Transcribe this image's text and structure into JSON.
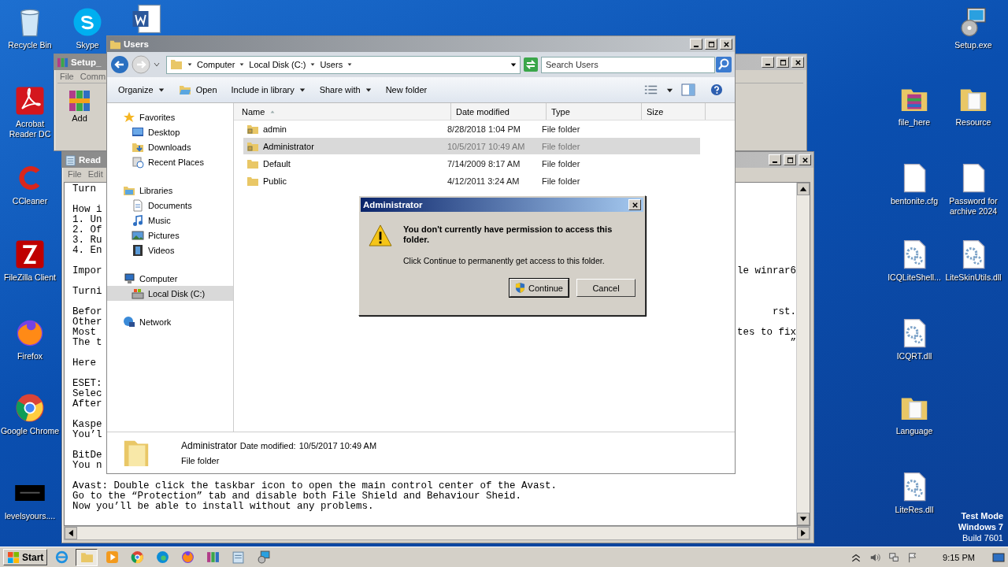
{
  "desktop_icons": [
    {
      "label": "Recycle Bin",
      "kind": "recycle"
    },
    {
      "label": "Skype",
      "kind": "skype"
    },
    {
      "kind": "word"
    },
    {
      "label": "Acrobat Reader DC",
      "kind": "pdf"
    },
    {
      "label": "CCleaner",
      "kind": "ccleaner"
    },
    {
      "label": "FileZilla Client",
      "kind": "filezilla"
    },
    {
      "label": "Firefox",
      "kind": "firefox"
    },
    {
      "label": "Google Chrome",
      "kind": "chrome"
    },
    {
      "label": "levelsyours....",
      "kind": "black"
    },
    {
      "label": "Setup.exe",
      "kind": "setup"
    },
    {
      "label": "file_here",
      "kind": "archive-folder"
    },
    {
      "label": "Resource",
      "kind": "folder"
    },
    {
      "label": "bentonite.cfg",
      "kind": "file"
    },
    {
      "label": "Password for archive 2024",
      "kind": "file"
    },
    {
      "label": "ICQLiteShell...",
      "kind": "dll"
    },
    {
      "label": "LiteSkinUtils.dll",
      "kind": "dll"
    },
    {
      "label": "ICQRT.dll",
      "kind": "dll"
    },
    {
      "label": "Language",
      "kind": "folder"
    },
    {
      "label": "LiteRes.dll",
      "kind": "dll"
    }
  ],
  "winrar": {
    "title": "Setup_",
    "menu": [
      "File",
      "Comm"
    ],
    "toolbar": [
      "Add"
    ]
  },
  "notepad": {
    "title": "Read",
    "menu": [
      "File",
      "Edit"
    ],
    "lines": [
      {
        "kind": "text",
        "left": "Turn"
      },
      {
        "kind": "blank"
      },
      {
        "kind": "text",
        "left": "How i"
      },
      {
        "kind": "text",
        "left": "1. Un"
      },
      {
        "kind": "text",
        "left": "2. Of"
      },
      {
        "kind": "text",
        "left": "3. Ru"
      },
      {
        "kind": "text",
        "left": "4. En"
      },
      {
        "kind": "blank"
      },
      {
        "kind": "text",
        "left": "Impor",
        "right": "le winrar6"
      },
      {
        "kind": "blank"
      },
      {
        "kind": "text",
        "left": "Turni"
      },
      {
        "kind": "blank"
      },
      {
        "kind": "text",
        "left": "Befor",
        "right": "rst."
      },
      {
        "kind": "text",
        "left": "Other"
      },
      {
        "kind": "text",
        "left": "Most",
        "right": "tes to fix"
      },
      {
        "kind": "text",
        "left": "The t",
        "right": "”"
      },
      {
        "kind": "blank"
      },
      {
        "kind": "text",
        "left": "Here"
      },
      {
        "kind": "blank"
      },
      {
        "kind": "text",
        "left": "ESET:"
      },
      {
        "kind": "text",
        "left": "Selec"
      },
      {
        "kind": "text",
        "left": "After"
      },
      {
        "kind": "blank"
      },
      {
        "kind": "text",
        "left": "Kaspe"
      },
      {
        "kind": "text",
        "left": "You’l"
      },
      {
        "kind": "blank"
      },
      {
        "kind": "text",
        "left": "BitDe"
      },
      {
        "kind": "text",
        "left": "You n"
      },
      {
        "kind": "blank"
      },
      {
        "kind": "text",
        "left": "Avast: Double click the taskbar icon to open the main control center of the Avast."
      },
      {
        "kind": "text",
        "left": "Go to the “Protection” tab and disable both File Shield and Behaviour Sheid."
      },
      {
        "kind": "text",
        "left": "Now you’ll be able to install without any problems."
      }
    ]
  },
  "explorer": {
    "title": "Users",
    "breadcrumb": [
      "Computer",
      "Local Disk (C:)",
      "Users"
    ],
    "search": {
      "placeholder": "Search Users"
    },
    "toolbar": [
      {
        "label": "Organize",
        "kind": "menu"
      },
      {
        "label": "Open",
        "kind": "open"
      },
      {
        "label": "Include in library",
        "kind": "menu"
      },
      {
        "label": "Share with",
        "kind": "menu"
      },
      {
        "label": "New folder",
        "kind": "plain"
      }
    ],
    "nav": [
      {
        "label": "Favorites",
        "kind": "star",
        "selected": false,
        "children": [
          {
            "label": "Desktop",
            "kind": "desktop",
            "selected": false
          },
          {
            "label": "Downloads",
            "kind": "downloads",
            "selected": false
          },
          {
            "label": "Recent Places",
            "kind": "recent",
            "selected": false
          }
        ]
      },
      {
        "label": "Libraries",
        "kind": "libraries",
        "selected": false,
        "children": [
          {
            "label": "Documents",
            "kind": "documents",
            "selected": false
          },
          {
            "label": "Music",
            "kind": "music",
            "selected": false
          },
          {
            "label": "Pictures",
            "kind": "pictures",
            "selected": false
          },
          {
            "label": "Videos",
            "kind": "videos",
            "selected": false
          }
        ]
      },
      {
        "label": "Computer",
        "kind": "computer",
        "selected": false,
        "children": [
          {
            "label": "Local Disk (C:)",
            "kind": "disk",
            "selected": true
          }
        ]
      },
      {
        "label": "Network",
        "kind": "network",
        "selected": false
      }
    ],
    "columns": [
      {
        "label": "Name",
        "sorted": true
      },
      {
        "label": "Date modified",
        "sorted": false
      },
      {
        "label": "Type",
        "sorted": false
      },
      {
        "label": "Size",
        "sorted": false
      }
    ],
    "rows": [
      {
        "name": "admin",
        "date": "8/28/2018 1:04 PM",
        "type": "File folder",
        "selected": false,
        "locked": true
      },
      {
        "name": "Administrator",
        "date": "10/5/2017 10:49 AM",
        "type": "File folder",
        "selected": true,
        "locked": true
      },
      {
        "name": "Default",
        "date": "7/14/2009 8:17 AM",
        "type": "File folder",
        "selected": false,
        "locked": false
      },
      {
        "name": "Public",
        "date": "4/12/2011 3:24 AM",
        "type": "File folder",
        "selected": false,
        "locked": false
      }
    ],
    "details": {
      "name": "Administrator",
      "date_label": "Date modified:",
      "date": "10/5/2017 10:49 AM",
      "type": "File folder"
    }
  },
  "dialog": {
    "title": "Administrator",
    "heading": "You don't currently have permission to access this folder.",
    "message": "Click Continue to permanently get access to this folder.",
    "buttons": [
      {
        "label": "Continue",
        "default": true
      },
      {
        "label": "Cancel",
        "default": false
      }
    ]
  },
  "taskbar": {
    "start": "Start",
    "apps": [
      {
        "kind": "ie",
        "selected": false
      },
      {
        "kind": "explorer",
        "selected": true
      },
      {
        "kind": "media",
        "selected": false
      },
      {
        "kind": "chrome",
        "selected": false
      },
      {
        "kind": "edge",
        "selected": false
      },
      {
        "kind": "firefox",
        "selected": false
      },
      {
        "kind": "winrar",
        "selected": false
      },
      {
        "kind": "notepad",
        "selected": false
      },
      {
        "kind": "setup",
        "selected": false
      }
    ],
    "time": "9:15 PM"
  },
  "watermark_os": [
    "Test Mode",
    "Windows 7",
    "Build 7601"
  ]
}
